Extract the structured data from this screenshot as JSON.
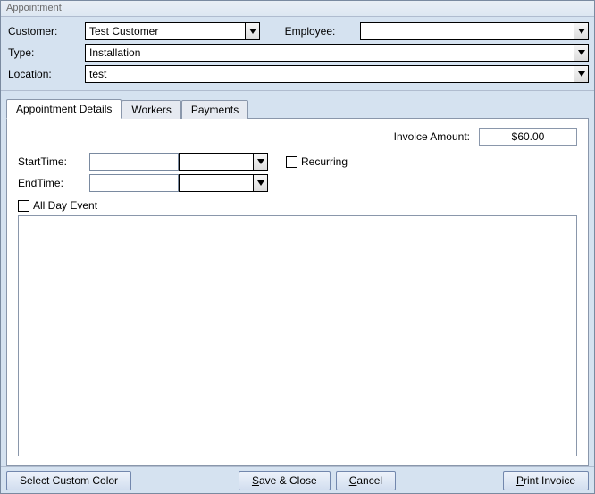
{
  "window": {
    "title": "Appointment"
  },
  "header": {
    "customer_label": "Customer:",
    "customer_value": "Test Customer",
    "employee_label": "Employee:",
    "employee_value": "",
    "type_label": "Type:",
    "type_value": "Installation",
    "location_label": "Location:",
    "location_value": "test"
  },
  "tabs": {
    "details": "Appointment Details",
    "workers": "Workers",
    "payments": "Payments"
  },
  "details": {
    "invoice_label": "Invoice Amount:",
    "invoice_value": "$60.00",
    "start_label": "StartTime:",
    "end_label": "EndTime:",
    "recurring_label": "Recurring",
    "allday_label": "All Day Event"
  },
  "footer": {
    "color": "Select Custom Color",
    "save": "Save & Close",
    "cancel": "Cancel",
    "print": "Print Invoice"
  }
}
